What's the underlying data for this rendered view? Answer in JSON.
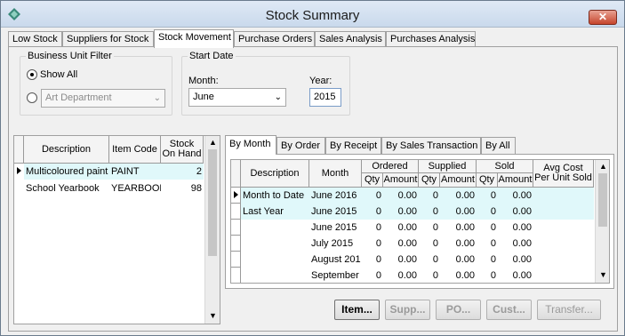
{
  "window": {
    "title": "Stock Summary",
    "close_label": "✕"
  },
  "tabs": [
    {
      "label": "Low Stock"
    },
    {
      "label": "Suppliers for Stock"
    },
    {
      "label": "Stock Movement"
    },
    {
      "label": "Purchase Orders"
    },
    {
      "label": "Sales Analysis"
    },
    {
      "label": "Purchases Analysis"
    }
  ],
  "active_tab": "Stock Movement",
  "business_unit": {
    "title": "Business Unit Filter",
    "show_all": "Show All",
    "department": "Art Department"
  },
  "start_date": {
    "title": "Start Date",
    "month_label": "Month:",
    "month_value": "June",
    "year_label": "Year:",
    "year_value": "2015"
  },
  "stock_grid": {
    "headers": {
      "description": "Description",
      "item_code": "Item Code",
      "stock_line1": "Stock",
      "stock_line2": "On Hand"
    },
    "rows": [
      {
        "description": "Multicoloured paint",
        "item_code": "PAINT",
        "stock": "2"
      },
      {
        "description": "School Yearbook",
        "item_code": "YEARBOOK",
        "stock": "98"
      }
    ]
  },
  "sub_tabs": [
    {
      "label": "By Month"
    },
    {
      "label": "By Order"
    },
    {
      "label": "By Receipt"
    },
    {
      "label": "By Sales Transaction"
    },
    {
      "label": "By All"
    }
  ],
  "movement_grid": {
    "headers": {
      "description": "Description",
      "month": "Month",
      "ordered": "Ordered",
      "supplied": "Supplied",
      "sold": "Sold",
      "avg_line1": "Avg Cost",
      "avg_line2": "Per Unit Sold",
      "qty": "Qty",
      "amount": "Amount"
    },
    "rows": [
      {
        "description": "Month to Date",
        "month": "June 2016",
        "oq": "0",
        "oa": "0.00",
        "sq": "0",
        "sa": "0.00",
        "lq": "0",
        "la": "0.00",
        "avg": ""
      },
      {
        "description": "Last Year",
        "month": "June 2015",
        "oq": "0",
        "oa": "0.00",
        "sq": "0",
        "sa": "0.00",
        "lq": "0",
        "la": "0.00",
        "avg": ""
      },
      {
        "description": "",
        "month": "June 2015",
        "oq": "0",
        "oa": "0.00",
        "sq": "0",
        "sa": "0.00",
        "lq": "0",
        "la": "0.00",
        "avg": ""
      },
      {
        "description": "",
        "month": "July 2015",
        "oq": "0",
        "oa": "0.00",
        "sq": "0",
        "sa": "0.00",
        "lq": "0",
        "la": "0.00",
        "avg": ""
      },
      {
        "description": "",
        "month": "August 201",
        "oq": "0",
        "oa": "0.00",
        "sq": "0",
        "sa": "0.00",
        "lq": "0",
        "la": "0.00",
        "avg": ""
      },
      {
        "description": "",
        "month": "September",
        "oq": "0",
        "oa": "0.00",
        "sq": "0",
        "sa": "0.00",
        "lq": "0",
        "la": "0.00",
        "avg": ""
      }
    ]
  },
  "buttons": {
    "item": "Item...",
    "supp": "Supp...",
    "po": "PO...",
    "cust": "Cust...",
    "transfer": "Transfer..."
  },
  "colors": {
    "selected_row": "#e0f8fa",
    "title_bar": "#c9d9ec",
    "close": "#c6452c"
  }
}
